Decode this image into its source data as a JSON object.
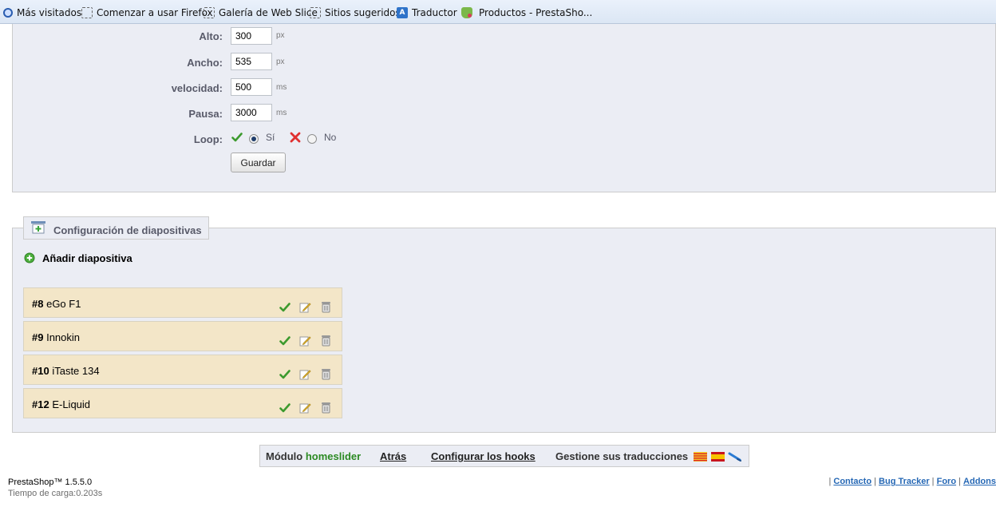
{
  "bookmarks": [
    {
      "label": "Más visitados",
      "icon": "search-bookmark-icon"
    },
    {
      "label": "Comenzar a usar Firefox",
      "icon": "dashed-page-icon"
    },
    {
      "label": "Galería de Web Slice",
      "icon": "dashed-page-icon"
    },
    {
      "label": "Sitios sugeridos",
      "icon": "dashed-page-icon"
    },
    {
      "label": "Traductor",
      "icon": "translator-icon"
    },
    {
      "label": "Productos - PrestaSho...",
      "icon": "prestashop-icon"
    }
  ],
  "settings": {
    "height": {
      "label": "Alto:",
      "value": "300",
      "unit": "px"
    },
    "width": {
      "label": "Ancho:",
      "value": "535",
      "unit": "px"
    },
    "speed": {
      "label": "velocidad:",
      "value": "500",
      "unit": "ms"
    },
    "pause": {
      "label": "Pausa:",
      "value": "3000",
      "unit": "ms"
    },
    "loop": {
      "label": "Loop:",
      "yes_label": "Sí",
      "no_label": "No",
      "selected": "yes"
    },
    "save_label": "Guardar"
  },
  "slides_config": {
    "title": "Configuración de diapositivas",
    "add_label": "Añadir diapositiva",
    "slides": [
      {
        "id": "#8",
        "name": "eGo F1"
      },
      {
        "id": "#9",
        "name": "Innokin"
      },
      {
        "id": "#10",
        "name": "iTaste 134"
      },
      {
        "id": "#12",
        "name": "E-Liquid"
      }
    ]
  },
  "toolbar": {
    "module_prefix": "Módulo",
    "module_name": "homeslider",
    "back_label": "Atrás",
    "hooks_label": "Configurar los hooks",
    "translations_label": "Gestione sus traducciones"
  },
  "footer": {
    "version": "PrestaShop™ 1.5.5.0",
    "load_time": "Tiempo de carga:0.203s",
    "links": [
      "Contacto",
      "Bug Tracker",
      "Foro",
      "Addons"
    ]
  },
  "colors": {
    "panel_bg": "#ebedf4",
    "slide_bg": "#f3e6c8",
    "module_name": "#2c8a23",
    "link": "#2668b5"
  }
}
